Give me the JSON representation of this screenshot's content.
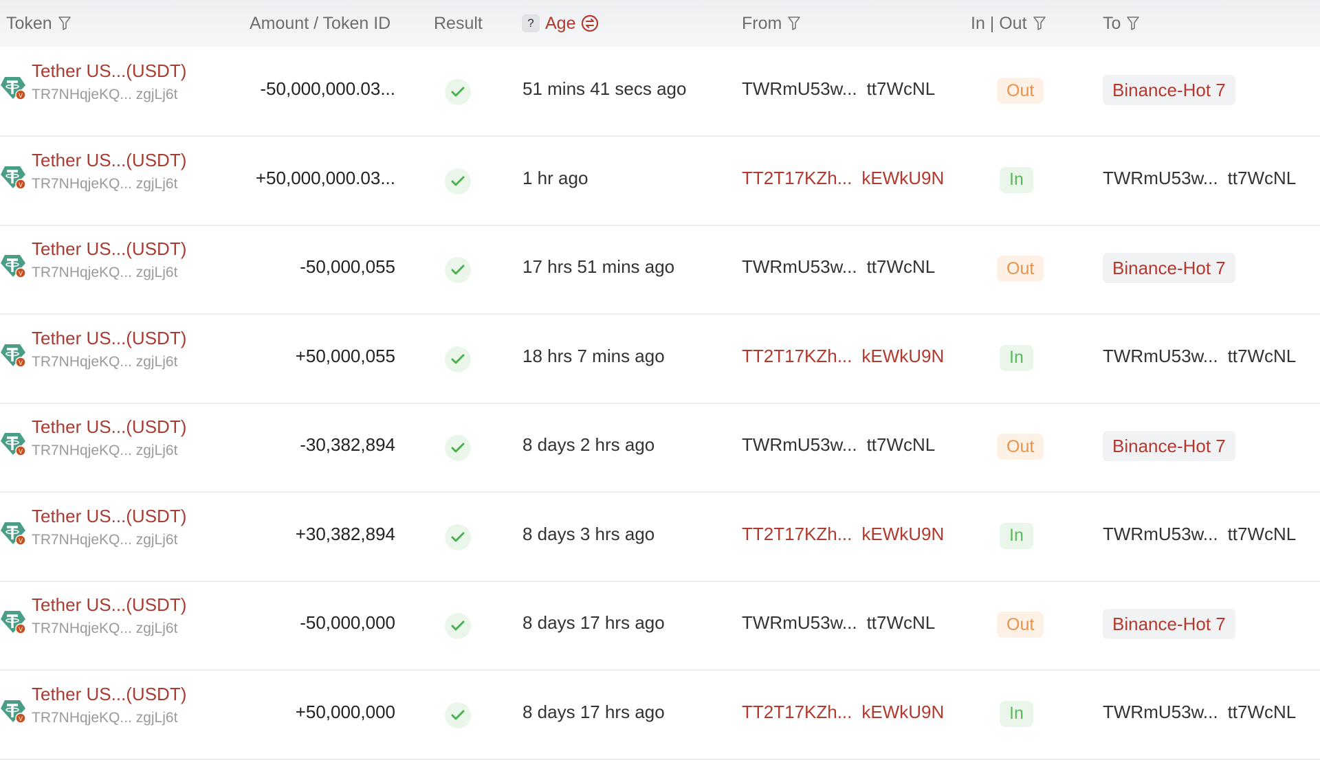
{
  "header": {
    "token": "Token",
    "amount": "Amount / Token ID",
    "result": "Result",
    "age_help": "?",
    "age": "Age",
    "from": "From",
    "inout": "In | Out",
    "to": "To"
  },
  "colors": {
    "accent": "#b3392e",
    "out_text": "#e8924a",
    "out_bg": "#fdf1e6",
    "in_text": "#5cb85c",
    "in_bg": "#eaf6ea",
    "tether": "#4a9d87"
  },
  "rows": [
    {
      "token": "Tether US...(USDT)",
      "contract": "TR7NHqjeKQ... zgjLj6t",
      "amount": "-50,000,000.03...",
      "result": "success",
      "age": "51 mins 41 secs ago",
      "from_a": "TWRmU53w...",
      "from_b": "tt7WcNL",
      "from_link": false,
      "direction": "Out",
      "to_a": "Binance-Hot 7",
      "to_b": "",
      "to_tag": true
    },
    {
      "token": "Tether US...(USDT)",
      "contract": "TR7NHqjeKQ... zgjLj6t",
      "amount": "+50,000,000.03...",
      "result": "success",
      "age": "1 hr ago",
      "from_a": "TT2T17KZh...",
      "from_b": "kEWkU9N",
      "from_link": true,
      "direction": "In",
      "to_a": "TWRmU53w...",
      "to_b": "tt7WcNL",
      "to_tag": false
    },
    {
      "token": "Tether US...(USDT)",
      "contract": "TR7NHqjeKQ... zgjLj6t",
      "amount": "-50,000,055",
      "result": "success",
      "age": "17 hrs 51 mins ago",
      "from_a": "TWRmU53w...",
      "from_b": "tt7WcNL",
      "from_link": false,
      "direction": "Out",
      "to_a": "Binance-Hot 7",
      "to_b": "",
      "to_tag": true
    },
    {
      "token": "Tether US...(USDT)",
      "contract": "TR7NHqjeKQ... zgjLj6t",
      "amount": "+50,000,055",
      "result": "success",
      "age": "18 hrs 7 mins ago",
      "from_a": "TT2T17KZh...",
      "from_b": "kEWkU9N",
      "from_link": true,
      "direction": "In",
      "to_a": "TWRmU53w...",
      "to_b": "tt7WcNL",
      "to_tag": false
    },
    {
      "token": "Tether US...(USDT)",
      "contract": "TR7NHqjeKQ... zgjLj6t",
      "amount": "-30,382,894",
      "result": "success",
      "age": "8 days 2 hrs ago",
      "from_a": "TWRmU53w...",
      "from_b": "tt7WcNL",
      "from_link": false,
      "direction": "Out",
      "to_a": "Binance-Hot 7",
      "to_b": "",
      "to_tag": true
    },
    {
      "token": "Tether US...(USDT)",
      "contract": "TR7NHqjeKQ... zgjLj6t",
      "amount": "+30,382,894",
      "result": "success",
      "age": "8 days 3 hrs ago",
      "from_a": "TT2T17KZh...",
      "from_b": "kEWkU9N",
      "from_link": true,
      "direction": "In",
      "to_a": "TWRmU53w...",
      "to_b": "tt7WcNL",
      "to_tag": false
    },
    {
      "token": "Tether US...(USDT)",
      "contract": "TR7NHqjeKQ... zgjLj6t",
      "amount": "-50,000,000",
      "result": "success",
      "age": "8 days 17 hrs ago",
      "from_a": "TWRmU53w...",
      "from_b": "tt7WcNL",
      "from_link": false,
      "direction": "Out",
      "to_a": "Binance-Hot 7",
      "to_b": "",
      "to_tag": true
    },
    {
      "token": "Tether US...(USDT)",
      "contract": "TR7NHqjeKQ... zgjLj6t",
      "amount": "+50,000,000",
      "result": "success",
      "age": "8 days 17 hrs ago",
      "from_a": "TT2T17KZh...",
      "from_b": "kEWkU9N",
      "from_link": true,
      "direction": "In",
      "to_a": "TWRmU53w...",
      "to_b": "tt7WcNL",
      "to_tag": false
    }
  ]
}
